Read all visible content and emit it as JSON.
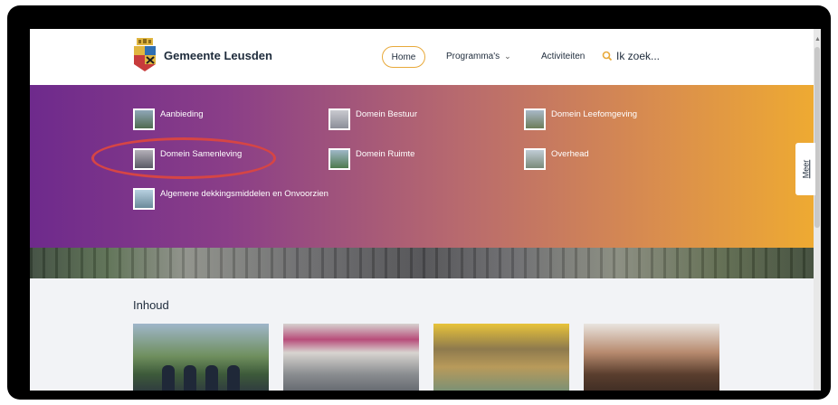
{
  "header": {
    "brand": "Gemeente Leusden",
    "nav": {
      "home": "Home",
      "programmas": "Programma's",
      "activiteiten": "Activiteiten"
    },
    "search": {
      "placeholder": "Ik zoek..."
    }
  },
  "menu": {
    "items": [
      {
        "label": "Aanbieding",
        "thumb_color": "#4f6a50"
      },
      {
        "label": "Domein Bestuur",
        "thumb_color": "#8b8f99"
      },
      {
        "label": "Domein Leefomgeving",
        "thumb_color": "#6d7d5a"
      },
      {
        "label": "Domein Samenleving",
        "thumb_color": "#5a5a66"
      },
      {
        "label": "Domein Ruimte",
        "thumb_color": "#4e7a4e"
      },
      {
        "label": "Overhead",
        "thumb_color": "#7a8a7a"
      },
      {
        "label": "Algemene dekkingsmiddelen en Onvoorzien",
        "thumb_color": "#6a8a9a"
      }
    ],
    "highlighted": "Domein Samenleving",
    "highlight_color": "#d64545"
  },
  "side_tab": {
    "label": "Meer"
  },
  "content": {
    "heading": "Inhoud"
  },
  "colors": {
    "accent": "#e8a93a",
    "gradient_start": "#6e2a8c",
    "gradient_end": "#eeaa32",
    "text": "#1e2b3b"
  }
}
